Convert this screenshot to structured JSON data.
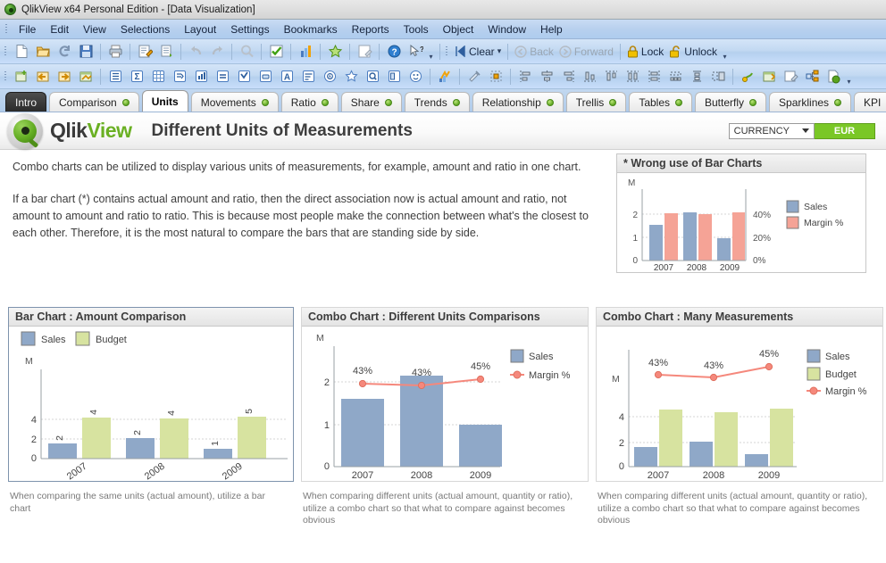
{
  "window": {
    "title": "QlikView x64 Personal Edition - [Data Visualization]",
    "logo_icon": "qlikview-orb-icon"
  },
  "menubar": {
    "items": [
      {
        "label": "File"
      },
      {
        "label": "Edit"
      },
      {
        "label": "View"
      },
      {
        "label": "Selections"
      },
      {
        "label": "Layout"
      },
      {
        "label": "Settings"
      },
      {
        "label": "Bookmarks"
      },
      {
        "label": "Reports"
      },
      {
        "label": "Tools"
      },
      {
        "label": "Object"
      },
      {
        "label": "Window"
      },
      {
        "label": "Help"
      }
    ]
  },
  "toolbar_standard": {
    "icons": [
      "new-document-icon",
      "open-document-icon",
      "reload-icon",
      "save-icon",
      "print-icon",
      "edit-script-icon",
      "table-viewer-icon",
      "undo-icon",
      "redo-icon",
      "search-icon",
      "current-selections-icon",
      "chart-icon",
      "favorites-icon",
      "edit-module-icon",
      "help-icon",
      "context-help-icon"
    ],
    "clear_label": "Clear",
    "clear_icon": "clear-selections-icon",
    "back_label": "Back",
    "back_icon": "back-arrow-icon",
    "forward_label": "Forward",
    "forward_icon": "forward-arrow-icon",
    "lock_label": "Lock",
    "lock_icon": "lock-closed-icon",
    "unlock_label": "Unlock",
    "unlock_icon": "lock-open-icon"
  },
  "toolbar_design": {
    "icons": [
      "new-sheet-icon",
      "previous-sheet-icon",
      "next-sheet-icon",
      "sheet-properties-icon",
      "list-box-icon",
      "statistics-box-icon",
      "table-box-icon",
      "multi-box-icon",
      "chart-object-icon",
      "input-box-icon",
      "current-selections-box-icon",
      "button-object-icon",
      "text-object-icon",
      "line-arrow-object-icon",
      "slider-calendar-icon",
      "bookmark-object-icon",
      "search-object-icon",
      "container-object-icon",
      "custom-object-icon",
      "system-table-icon",
      "design-grid-icon",
      "snap-to-grid-icon",
      "align-left-icon",
      "align-center-icon",
      "align-right-icon",
      "align-bottom-icon",
      "align-top-icon",
      "distribute-horizontal-icon",
      "distribute-vertical-icon",
      "space-across-icon",
      "space-down-icon",
      "size-equal-icon",
      "promote-icon",
      "demote-icon",
      "edit-expression-icon",
      "link-objects-icon",
      "web-publish-icon"
    ]
  },
  "tabs": {
    "items": [
      {
        "label": "Intro",
        "style": "intro",
        "dot": false
      },
      {
        "label": "Comparison",
        "style": "normal",
        "dot": true
      },
      {
        "label": "Units",
        "style": "active",
        "dot": false
      },
      {
        "label": "Movements",
        "style": "normal",
        "dot": true
      },
      {
        "label": "Ratio",
        "style": "normal",
        "dot": true
      },
      {
        "label": "Share",
        "style": "normal",
        "dot": true
      },
      {
        "label": "Trends",
        "style": "normal",
        "dot": true
      },
      {
        "label": "Relationship",
        "style": "normal",
        "dot": true
      },
      {
        "label": "Trellis",
        "style": "normal",
        "dot": true
      },
      {
        "label": "Tables",
        "style": "normal",
        "dot": true
      },
      {
        "label": "Butterfly",
        "style": "normal",
        "dot": true
      },
      {
        "label": "Sparklines",
        "style": "normal",
        "dot": true
      },
      {
        "label": "KPI",
        "style": "normal",
        "dot": false
      }
    ]
  },
  "header": {
    "brand_first": "Qlik",
    "brand_second": "View",
    "sheet_title": "Different Units of Measurements",
    "currency_label": "CURRENCY",
    "currency_value": "EUR",
    "currency_color": "#7ac726"
  },
  "body": {
    "paragraph_1": "Combo charts can be utilized to display various units of measurements, for example, amount and ratio in one chart.",
    "paragraph_2": "If a bar chart (*) contains actual amount and ratio, then the direct association now is actual amount and ratio, not amount to amount and ratio to ratio. This is because most people make the connection between what's the closest to each other. Therefore, it is the most natural to compare the bars that are standing side by side."
  },
  "captions": {
    "bar_chart": "When comparing the same units (actual amount), utilize a bar chart",
    "combo_units": "When comparing different units (actual amount, quantity or ratio), utilize a combo chart so that what to compare against becomes obvious",
    "combo_many": "When comparing different units (actual amount, quantity or ratio), utilize a combo chart so that what to compare against becomes obvious"
  },
  "colors": {
    "sales": "#8fa8c8",
    "budget": "#d7e3a0",
    "margin": "#f5887c",
    "grid": "#cfcfcf",
    "axis": "#9aa0a6"
  },
  "chart_data": [
    {
      "id": "wrong-use-bar-chart",
      "type": "bar",
      "title": "* Wrong use of Bar Charts",
      "categories": [
        "2007",
        "2008",
        "2009"
      ],
      "series": [
        {
          "name": "Sales",
          "values": [
            1.55,
            2.1,
            0.95
          ],
          "color": "#8fa8c8",
          "axis": "left"
        },
        {
          "name": "Margin %",
          "values": [
            43,
            43,
            45
          ],
          "color": "#f5887c",
          "axis": "right"
        }
      ],
      "ylabel": "M",
      "ylim": [
        0,
        2.6
      ],
      "yticks": [
        0,
        1,
        2
      ],
      "ytick_labels": [
        "0",
        "1",
        "2"
      ],
      "y2lim": [
        0,
        52
      ],
      "y2ticks": [
        0,
        20,
        40
      ],
      "y2tick_labels": [
        "0%",
        "20%",
        "40%"
      ],
      "grid": true,
      "legend": "right"
    },
    {
      "id": "bar-chart-amount-comparison",
      "type": "bar",
      "title": "Bar Chart : Amount Comparison",
      "categories": [
        "2007",
        "2008",
        "2009"
      ],
      "series": [
        {
          "name": "Sales",
          "values": [
            1.6,
            2.1,
            1.0
          ],
          "color": "#8fa8c8",
          "labels": [
            "2",
            "2",
            "1"
          ]
        },
        {
          "name": "Budget",
          "values": [
            4.3,
            4.2,
            4.4
          ],
          "color": "#d7e3a0",
          "labels": [
            "4",
            "4",
            "5"
          ]
        }
      ],
      "ylabel": "M",
      "ylim": [
        0,
        11
      ],
      "yticks": [
        0,
        2,
        4
      ],
      "ytick_labels": [
        "0",
        "2",
        "4"
      ],
      "grid": true,
      "legend": "top-left"
    },
    {
      "id": "combo-chart-different-units",
      "type": "bar",
      "title": "Combo Chart : Different Units Comparisons",
      "categories": [
        "2007",
        "2008",
        "2009"
      ],
      "series": [
        {
          "name": "Sales",
          "values": [
            1.58,
            2.11,
            0.97
          ],
          "color": "#8fa8c8",
          "kind": "bar",
          "axis": "left"
        },
        {
          "name": "Margin %",
          "values": [
            43,
            43,
            45
          ],
          "color": "#f5887c",
          "kind": "line",
          "axis": "right",
          "point_labels": [
            "43%",
            "43%",
            "45%"
          ]
        }
      ],
      "ylabel": "M",
      "ylim": [
        0,
        2.75
      ],
      "yticks": [
        0,
        1,
        2
      ],
      "ytick_labels": [
        "0",
        "1",
        "2"
      ],
      "grid": true,
      "legend": "right"
    },
    {
      "id": "combo-chart-many-measurements",
      "type": "bar",
      "title": "Combo Chart : Many Measurements",
      "categories": [
        "2007",
        "2008",
        "2009"
      ],
      "series": [
        {
          "name": "Sales",
          "values": [
            1.6,
            2.15,
            0.95
          ],
          "color": "#8fa8c8",
          "kind": "bar",
          "axis": "left"
        },
        {
          "name": "Budget",
          "values": [
            4.4,
            4.25,
            4.45
          ],
          "color": "#d7e3a0",
          "kind": "bar",
          "axis": "left"
        },
        {
          "name": "Margin %",
          "values": [
            43,
            43,
            45
          ],
          "color": "#f5887c",
          "kind": "line",
          "axis": "right",
          "point_labels": [
            "43%",
            "43%",
            "45%"
          ]
        }
      ],
      "ylabel": "M",
      "ylim": [
        0,
        11
      ],
      "yticks": [
        0,
        2,
        4
      ],
      "ytick_labels": [
        "0",
        "2",
        "4"
      ],
      "grid": true,
      "legend": "right"
    }
  ]
}
